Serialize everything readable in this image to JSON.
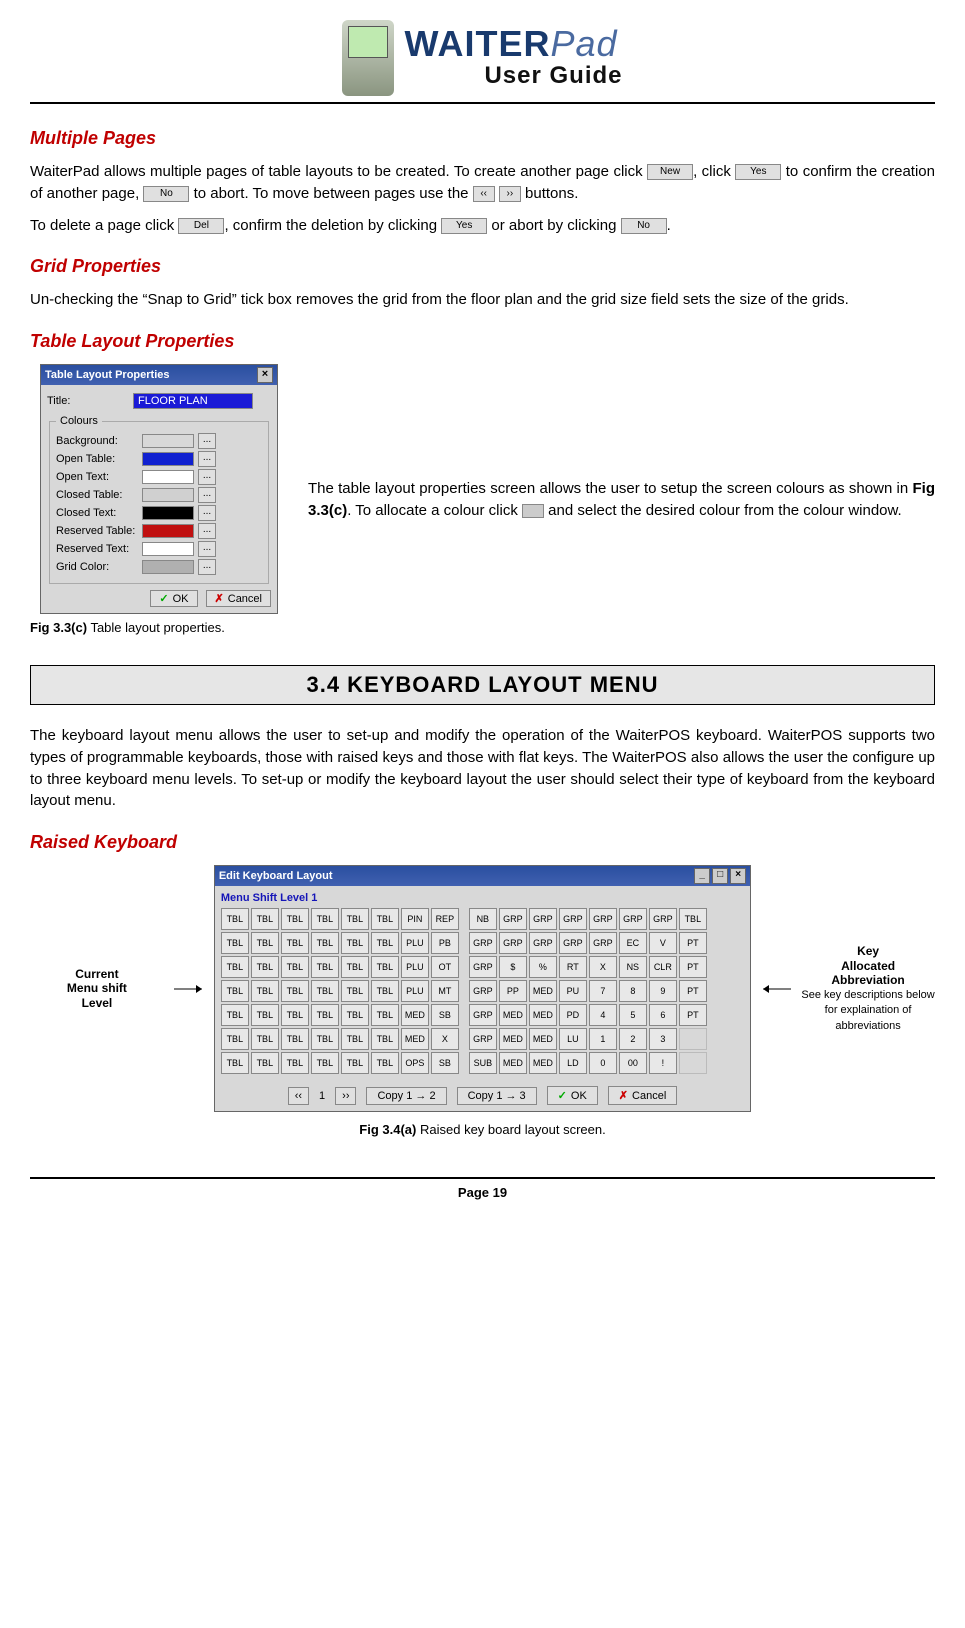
{
  "brand": {
    "main": "WAITER",
    "pad": "Pad",
    "sub": "User Guide"
  },
  "headings": {
    "multiple_pages": "Multiple Pages",
    "grid_properties": "Grid Properties",
    "table_layout_properties": "Table Layout Properties",
    "section_bar": "3.4     KEYBOARD LAYOUT MENU",
    "raised_keyboard": "Raised Keyboard"
  },
  "paragraphs": {
    "mp1_a": "WaiterPad allows multiple pages of table layouts to be created. To create another page click ",
    "mp1_b": ", click ",
    "mp1_c": " to confirm the creation of another page, ",
    "mp1_d": " to abort. To move between pages use the ",
    "mp1_e": " buttons.",
    "mp2_a": "To delete a page click ",
    "mp2_b": ", confirm the deletion by clicking ",
    "mp2_c": " or abort by clicking ",
    "mp2_d": ".",
    "grid": "Un-checking the “Snap to Grid” tick box removes the grid from the floor plan and the grid size field sets the size of the grids.",
    "tlp_a": "The table layout properties screen allows the user to setup the screen colours as shown in ",
    "tlp_b": ". To allocate a colour click ",
    "tlp_c": " and select the desired colour from the colour window.",
    "tlp_fig_ref": "Fig 3.3(c)",
    "kbd_intro": "The keyboard layout menu allows the user to set-up and modify the operation of the WaiterPOS keyboard. WaiterPOS supports two types of programmable keyboards, those with raised keys and those with flat keys. The WaiterPOS also allows the user the configure up to three keyboard menu levels. To set-up or modify the keyboard layout the user should select their type of keyboard from the keyboard layout menu."
  },
  "inline_buttons": {
    "new": "New",
    "yes": "Yes",
    "no": "No",
    "prev": "‹‹",
    "next": "››",
    "del": "Del"
  },
  "fig33c": {
    "title": "Table Layout Properties",
    "title_label": "Title:",
    "title_value": "FLOOR PLAN",
    "colours_legend": "Colours",
    "rows": [
      {
        "label": "Background:",
        "color": "#d8d8d8"
      },
      {
        "label": "Open Table:",
        "color": "#1020d0"
      },
      {
        "label": "Open Text:",
        "color": "#ffffff"
      },
      {
        "label": "Closed Table:",
        "color": "#d0d0d0"
      },
      {
        "label": "Closed Text:",
        "color": "#000000"
      },
      {
        "label": "Reserved Table:",
        "color": "#c01010"
      },
      {
        "label": "Reserved Text:",
        "color": "#ffffff"
      },
      {
        "label": "Grid Color:",
        "color": "#b0b0b0"
      }
    ],
    "ok": "OK",
    "cancel": "Cancel",
    "caption_bold": "Fig 3.3(c)",
    "caption_rest": " Table layout properties."
  },
  "kbd": {
    "dialog_title": "Edit Keyboard Layout",
    "shift_label": "Menu Shift Level 1",
    "left_grid": [
      [
        "TBL",
        "TBL",
        "TBL",
        "TBL",
        "TBL",
        "TBL",
        "PIN",
        "REP"
      ],
      [
        "TBL",
        "TBL",
        "TBL",
        "TBL",
        "TBL",
        "TBL",
        "PLU",
        "PB"
      ],
      [
        "TBL",
        "TBL",
        "TBL",
        "TBL",
        "TBL",
        "TBL",
        "PLU",
        "OT"
      ],
      [
        "TBL",
        "TBL",
        "TBL",
        "TBL",
        "TBL",
        "TBL",
        "PLU",
        "MT"
      ],
      [
        "TBL",
        "TBL",
        "TBL",
        "TBL",
        "TBL",
        "TBL",
        "MED",
        "SB"
      ],
      [
        "TBL",
        "TBL",
        "TBL",
        "TBL",
        "TBL",
        "TBL",
        "MED",
        "X"
      ],
      [
        "TBL",
        "TBL",
        "TBL",
        "TBL",
        "TBL",
        "TBL",
        "OPS",
        "SB"
      ]
    ],
    "right_grid": [
      [
        "NB",
        "GRP",
        "GRP",
        "GRP",
        "GRP",
        "GRP",
        "GRP",
        "TBL"
      ],
      [
        "GRP",
        "GRP",
        "GRP",
        "GRP",
        "GRP",
        "EC",
        "V",
        "PT"
      ],
      [
        "GRP",
        "$",
        "%",
        "RT",
        "X",
        "NS",
        "CLR",
        "PT"
      ],
      [
        "GRP",
        "PP",
        "MED",
        "PU",
        "7",
        "8",
        "9",
        "PT"
      ],
      [
        "GRP",
        "MED",
        "MED",
        "PD",
        "4",
        "5",
        "6",
        "PT"
      ],
      [
        "GRP",
        "MED",
        "MED",
        "LU",
        "1",
        "2",
        "3",
        ""
      ],
      [
        "SUB",
        "MED",
        "MED",
        "LD",
        "0",
        "00",
        "!",
        ""
      ]
    ],
    "toolbar": {
      "prev": "‹‹",
      "page": "1",
      "next": "››",
      "copy12": "Copy 1 → 2",
      "copy13": "Copy 1 → 3",
      "ok": "OK",
      "cancel": "Cancel"
    },
    "caption_bold": "Fig 3.4(a)",
    "caption_rest": " Raised key board layout screen.",
    "callout_left": "Current\nMenu shift\nLevel",
    "callout_right_main": "Key\nAllocated\nAbbreviation",
    "callout_right_sub": "See key descriptions below for explaination of abbreviations"
  },
  "footer": "Page 19"
}
